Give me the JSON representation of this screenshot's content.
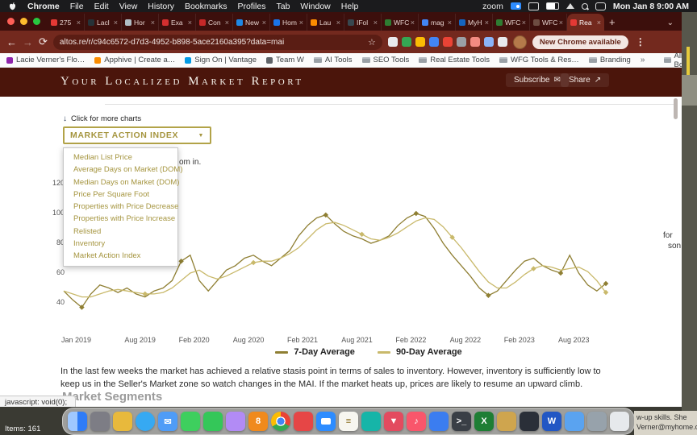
{
  "menu_bar": {
    "items": [
      "Chrome",
      "File",
      "Edit",
      "View",
      "History",
      "Bookmarks",
      "Profiles",
      "Tab",
      "Window",
      "Help"
    ],
    "status": {
      "zoom_label": "zoom",
      "clock": "Mon Jan 8  9:00 AM"
    }
  },
  "tabs": {
    "active_index": 14,
    "list": [
      {
        "label": "275",
        "color": "#e53935"
      },
      {
        "label": "Lacl",
        "color": "#263238"
      },
      {
        "label": "Hor",
        "color": "#b0bec5"
      },
      {
        "label": "Exa",
        "color": "#d32f2f"
      },
      {
        "label": "Con",
        "color": "#c62828"
      },
      {
        "label": "New",
        "color": "#1e88e5"
      },
      {
        "label": "Hom",
        "color": "#1a73e8"
      },
      {
        "label": "Lau",
        "color": "#fb8c00"
      },
      {
        "label": "IFol",
        "color": "#37474f"
      },
      {
        "label": "WFC",
        "color": "#2e7d32"
      },
      {
        "label": "mag",
        "color": "#4285f4"
      },
      {
        "label": "MyH",
        "color": "#1565c0"
      },
      {
        "label": "WFC",
        "color": "#2e7d32"
      },
      {
        "label": "WFC",
        "color": "#6d4c41"
      },
      {
        "label": "Rea",
        "color": "#e53935"
      }
    ]
  },
  "toolbar": {
    "url": "altos.re/r/c94c6572-d7d3-4952-b898-5ace2160a395?data=mai",
    "update_button": "New Chrome available",
    "extensions": [
      {
        "name": "extension-1",
        "color": "#e8eaed"
      },
      {
        "name": "extension-2",
        "color": "#34a853"
      },
      {
        "name": "extension-3",
        "color": "#fbbc04"
      },
      {
        "name": "extension-4",
        "color": "#4285f4"
      },
      {
        "name": "extension-5",
        "color": "#ea4335"
      },
      {
        "name": "extension-6",
        "color": "#9aa0a6"
      },
      {
        "name": "extension-7",
        "color": "#f28b82"
      },
      {
        "name": "extension-8",
        "color": "#8ab4f8"
      },
      {
        "name": "extension-9",
        "color": "#e8eaed"
      }
    ]
  },
  "bookmarks": {
    "items": [
      {
        "label": "Lacie Verner's Flo…",
        "type": "site",
        "color": "#8e24aa"
      },
      {
        "label": "Apphive | Create a…",
        "type": "site",
        "color": "#fb8c00"
      },
      {
        "label": "Sign On | Vantage",
        "type": "site",
        "color": "#039be5"
      },
      {
        "label": "Team W",
        "type": "site",
        "color": "#5f6368"
      },
      {
        "label": "AI Tools",
        "type": "folder"
      },
      {
        "label": "SEO Tools",
        "type": "folder"
      },
      {
        "label": "Real Estate Tools",
        "type": "folder"
      },
      {
        "label": "WFG Tools & Res…",
        "type": "folder"
      },
      {
        "label": "Branding",
        "type": "folder"
      }
    ],
    "overflow": "»",
    "all_bookmarks": "All Bookmarks"
  },
  "page": {
    "header": {
      "title": "Your Localized Market Report",
      "subscribe_label": "Subscribe",
      "share_label": "Share"
    },
    "click_more_label": "Click for more charts",
    "dropdown": {
      "selected": "Market Action Index",
      "items": [
        "Median List Price",
        "Average Days on Market (DOM)",
        "Median Days on Market (DOM)",
        "Price Per Square Foot",
        "Properties with Price Decrease",
        "Properties with Price Increase",
        "Relisted",
        "Inventory",
        "Market Action Index"
      ]
    },
    "fragments": {
      "zoom": "om in.",
      "right_1": "for",
      "right_2": "son is"
    },
    "paragraph": "In the last few weeks the market has achieved a relative stasis point in terms of sales to inventory. However, inventory is sufficiently low to keep us in the Seller's Market zone so watch changes in the MAI. If the market heats up, prices are likely to resume an upward climb.",
    "section_heading": "Market Segments",
    "status_tooltip": "javascript: void(0);"
  },
  "chart_data": {
    "type": "line",
    "title": "Market Action Index",
    "x_tick_labels": [
      "Jan 2019",
      "Aug 2019",
      "Feb 2020",
      "Aug 2020",
      "Feb 2021",
      "Aug 2021",
      "Feb 2022",
      "Aug 2022",
      "Feb 2023",
      "Aug 2023"
    ],
    "x_tick_months": [
      0,
      7,
      13,
      19,
      25,
      31,
      37,
      43,
      49,
      55
    ],
    "y_ticks": [
      40,
      60,
      80,
      100,
      120
    ],
    "ylim": [
      30,
      125
    ],
    "legend_position": "bottom-center",
    "grid": false,
    "series": [
      {
        "name": "7-Day Average",
        "color": "#8f7f33",
        "marker_indices": [
          2,
          13,
          29,
          39,
          47,
          55,
          60
        ],
        "values": [
          48,
          42,
          37,
          46,
          52,
          50,
          47,
          50,
          46,
          44,
          48,
          50,
          55,
          68,
          72,
          55,
          48,
          55,
          62,
          65,
          70,
          72,
          68,
          65,
          70,
          75,
          85,
          92,
          97,
          99,
          93,
          88,
          85,
          83,
          80,
          82,
          85,
          92,
          97,
          100,
          98,
          90,
          80,
          72,
          65,
          58,
          50,
          45,
          48,
          55,
          62,
          68,
          70,
          65,
          62,
          60,
          72,
          60,
          52,
          48,
          53
        ]
      },
      {
        "name": "90-Day Average",
        "color": "#c9b96b",
        "marker_indices": [
          9,
          21,
          33,
          43,
          52,
          60
        ],
        "values": [
          48,
          46,
          44,
          44,
          46,
          48,
          49,
          48,
          47,
          46,
          46,
          47,
          50,
          55,
          60,
          62,
          58,
          56,
          58,
          61,
          64,
          67,
          68,
          68,
          70,
          73,
          77,
          83,
          89,
          93,
          94,
          92,
          89,
          86,
          83,
          82,
          84,
          87,
          91,
          95,
          97,
          96,
          91,
          84,
          77,
          69,
          61,
          54,
          50,
          50,
          54,
          59,
          63,
          65,
          64,
          62,
          63,
          64,
          61,
          55,
          47
        ]
      }
    ]
  },
  "desktop": {
    "items_count": "Items: 161",
    "note_line1": "w-up skills. She",
    "note_line2": "Verner@myhome.c"
  },
  "dock": {
    "icons": [
      {
        "name": "finder",
        "color": "#2f7cf7"
      },
      {
        "name": "launchpad",
        "color": "#7d7d85"
      },
      {
        "name": "app-library",
        "color": "#e8b93c"
      },
      {
        "name": "safari",
        "color": "#36a9f2"
      },
      {
        "name": "mail",
        "color": "#4f9cf7",
        "glyph": "✉"
      },
      {
        "name": "messages",
        "color": "#3ecf5e"
      },
      {
        "name": "facetime",
        "color": "#34c759"
      },
      {
        "name": "photos",
        "color": "#b28bf5"
      },
      {
        "name": "numbers-8",
        "color": "#f08a1d",
        "glyph": "8"
      },
      {
        "name": "chrome",
        "color": "#ffffff"
      },
      {
        "name": "reminders",
        "color": "#e64646"
      },
      {
        "name": "zoom",
        "color": "#2d8cff"
      },
      {
        "name": "notes",
        "color": "#f7f6f0",
        "glyph": "≡",
        "fg": "#8a6d1f"
      },
      {
        "name": "teams",
        "color": "#16b5a8"
      },
      {
        "name": "maps",
        "color": "#e34b5f",
        "glyph": "▼"
      },
      {
        "name": "music",
        "color": "#f9566b",
        "glyph": "♪"
      },
      {
        "name": "docs",
        "color": "#3b7df0"
      },
      {
        "name": "terminal",
        "color": "#3a3f46",
        "glyph": ">_"
      },
      {
        "name": "excel",
        "color": "#1e7e34",
        "glyph": "X"
      },
      {
        "name": "folder",
        "color": "#cfa54e"
      },
      {
        "name": "keynote",
        "color": "#2a2f38"
      },
      {
        "name": "word",
        "color": "#2257c4",
        "glyph": "W"
      },
      {
        "name": "onedrive",
        "color": "#5aa3f0"
      },
      {
        "name": "downloads",
        "color": "#97a2ab"
      },
      {
        "name": "trash",
        "color": "#e6e9ec"
      }
    ]
  }
}
